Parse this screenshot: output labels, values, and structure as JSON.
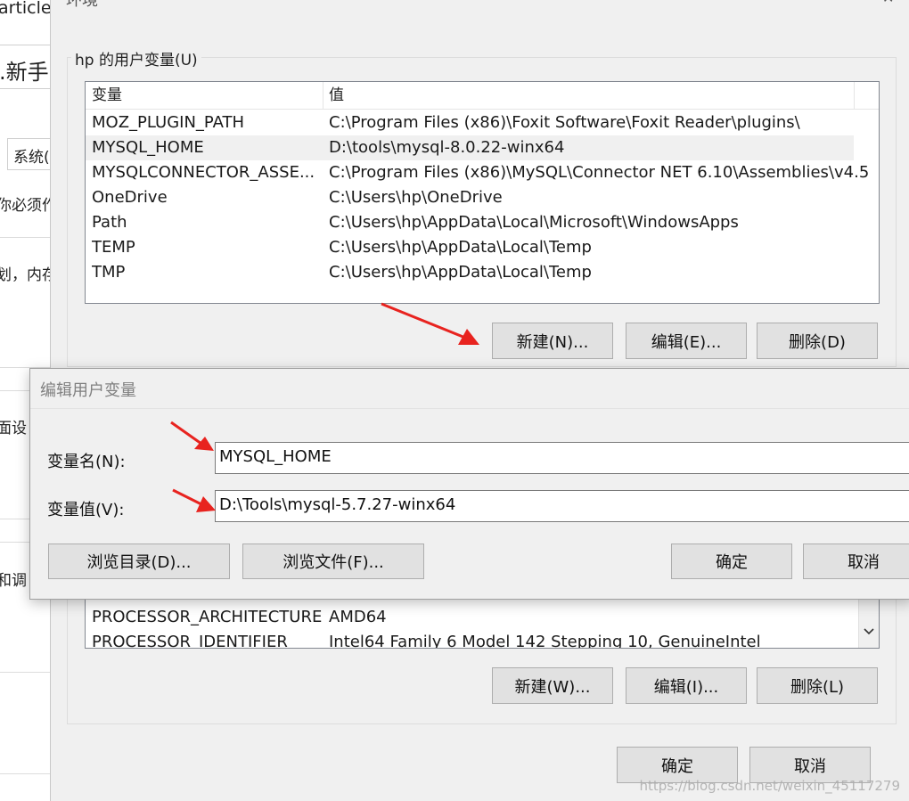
{
  "left_window": {
    "frag_article": "article",
    "frag_new": ".新手",
    "frag_tab": "系统(",
    "frag_must": "你必须作",
    "frag_plan": "划，内存",
    "frag_face": "面设",
    "frag_and": "和调"
  },
  "env_dialog": {
    "title_fragment": "环境",
    "close_icon": "✕",
    "user_group_label": "hp 的用户变量(U)",
    "columns": [
      "变量",
      "值"
    ],
    "user_vars": [
      {
        "name": "MOZ_PLUGIN_PATH",
        "value": "C:\\Program Files (x86)\\Foxit Software\\Foxit Reader\\plugins\\"
      },
      {
        "name": "MYSQL_HOME",
        "value": "D:\\tools\\mysql-8.0.22-winx64"
      },
      {
        "name": "MYSQLCONNECTOR_ASSE...",
        "value": "C:\\Program Files (x86)\\MySQL\\Connector NET 6.10\\Assemblies\\v4.5"
      },
      {
        "name": "OneDrive",
        "value": "C:\\Users\\hp\\OneDrive"
      },
      {
        "name": "Path",
        "value": "C:\\Users\\hp\\AppData\\Local\\Microsoft\\WindowsApps"
      },
      {
        "name": "TEMP",
        "value": "C:\\Users\\hp\\AppData\\Local\\Temp"
      },
      {
        "name": "TMP",
        "value": "C:\\Users\\hp\\AppData\\Local\\Temp"
      }
    ],
    "user_buttons": {
      "new": "新建(N)...",
      "edit": "编辑(E)...",
      "delete": "删除(D)"
    },
    "system_vars": [
      {
        "name": "PROCESSOR_ARCHITECTURE",
        "value": "AMD64"
      },
      {
        "name": "PROCESSOR_IDENTIFIER",
        "value": "Intel64 Family 6 Model 142 Stepping 10, GenuineIntel"
      }
    ],
    "system_buttons": {
      "new": "新建(W)...",
      "edit": "编辑(I)...",
      "delete": "删除(L)"
    },
    "ok": "确定",
    "cancel": "取消"
  },
  "edit_dialog": {
    "title": "编辑用户变量",
    "name_label": "变量名(N):",
    "name_value": "MYSQL_HOME",
    "value_label": "变量值(V):",
    "value_value": "D:\\Tools\\mysql-5.7.27-winx64",
    "browse_dir": "浏览目录(D)...",
    "browse_file": "浏览文件(F)...",
    "ok": "确定",
    "cancel": "取消"
  },
  "watermark": "https://blog.csdn.net/weixin_45117279",
  "colors": {
    "annotation_arrow": "#e8231f"
  }
}
